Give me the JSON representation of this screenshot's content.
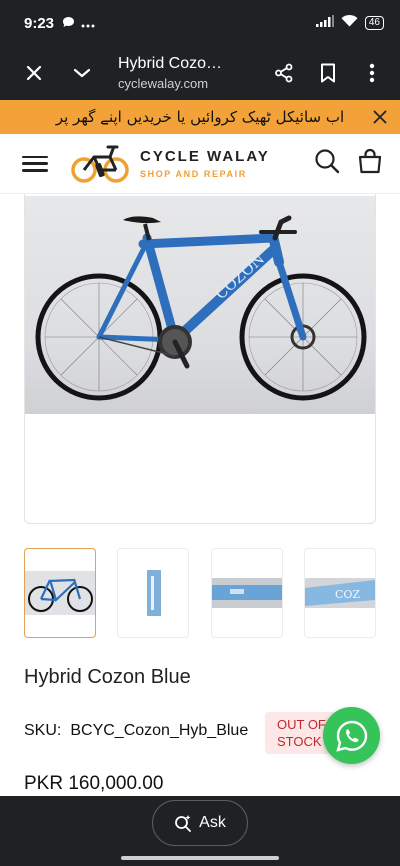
{
  "status_bar": {
    "time": "9:23",
    "battery": "46"
  },
  "browser": {
    "title": "Hybrid Cozo…",
    "url": "cyclewalay.com"
  },
  "announcement": {
    "text": "اب سائیکل ٹھیک کروائیں یا خریدیں اپنے گھر پر"
  },
  "logo": {
    "name": "CYCLE WALAY",
    "tagline": "SHOP AND REPAIR"
  },
  "colors": {
    "accent": "#f3a23a",
    "dark": "#1f2225",
    "whatsapp": "#35c35a",
    "stock_red": "#c0282d"
  },
  "product": {
    "title": "Hybrid Cozon Blue",
    "sku_label": "SKU:",
    "sku": "BCYC_Cozon_Hyb_Blue",
    "stock_line1": "OUT OF",
    "stock_line2": "STOCK",
    "price": "PKR 160,000.00",
    "frame_lettering": "COZON",
    "thumb_lettering": "COZ"
  },
  "bottom": {
    "ask_label": "Ask"
  }
}
